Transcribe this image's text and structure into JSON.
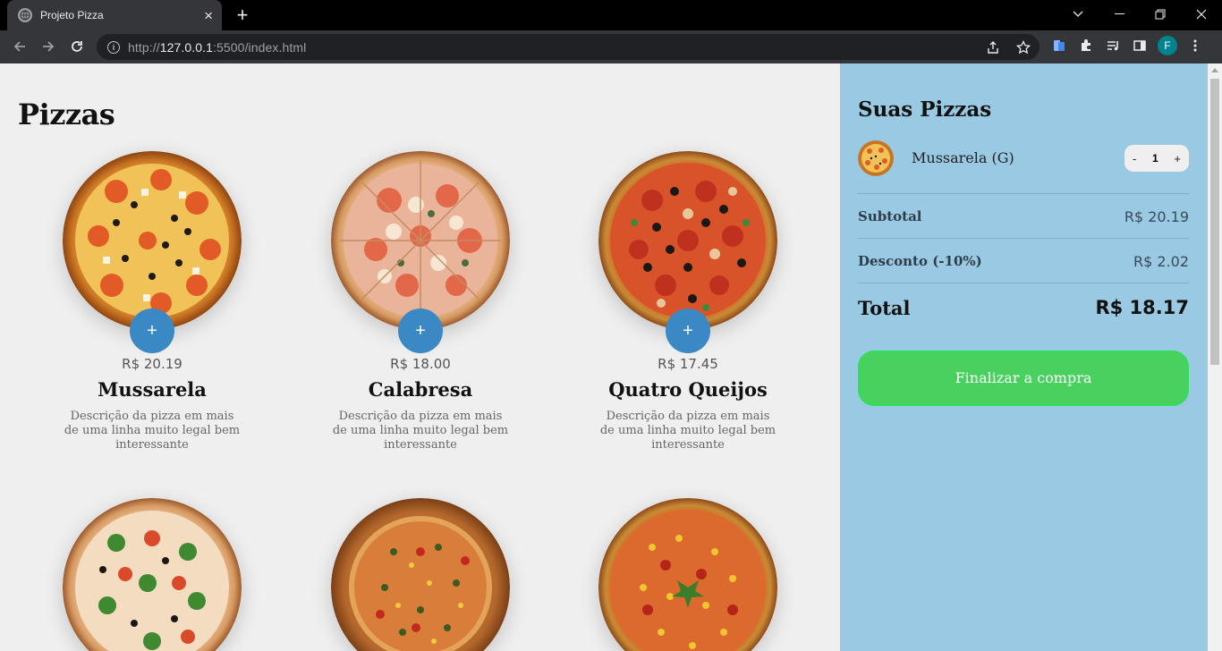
{
  "browser": {
    "tab_title": "Projeto Pizza",
    "url_scheme": "http://",
    "url_host": "127.0.0.1",
    "url_rest": ":5500/index.html",
    "profile_initial": "F"
  },
  "page": {
    "title": "Pizzas",
    "pizzas": [
      {
        "price": "R$ 20.19",
        "name": "Mussarela",
        "description": "Descrição da pizza em mais de uma linha muito legal bem interessante",
        "add_label": "+"
      },
      {
        "price": "R$ 18.00",
        "name": "Calabresa",
        "description": "Descrição da pizza em mais de uma linha muito legal bem interessante",
        "add_label": "+"
      },
      {
        "price": "R$ 17.45",
        "name": "Quatro Queijos",
        "description": "Descrição da pizza em mais de uma linha muito legal bem interessante",
        "add_label": "+"
      }
    ]
  },
  "cart": {
    "title": "Suas Pizzas",
    "item_name": "Mussarela (G)",
    "qty_minus": "-",
    "qty_value": "1",
    "qty_plus": "+",
    "subtotal_label": "Subtotal",
    "subtotal_value": "R$ 20.19",
    "discount_label": "Desconto (-10%)",
    "discount_value": "R$ 2.02",
    "total_label": "Total",
    "total_value": "R$ 18.17",
    "finish_label": "Finalizar a compra"
  },
  "colors": {
    "accent": "#3a88c4",
    "aside_bg": "#9ac9e3",
    "finish_bg": "#48d15e"
  }
}
